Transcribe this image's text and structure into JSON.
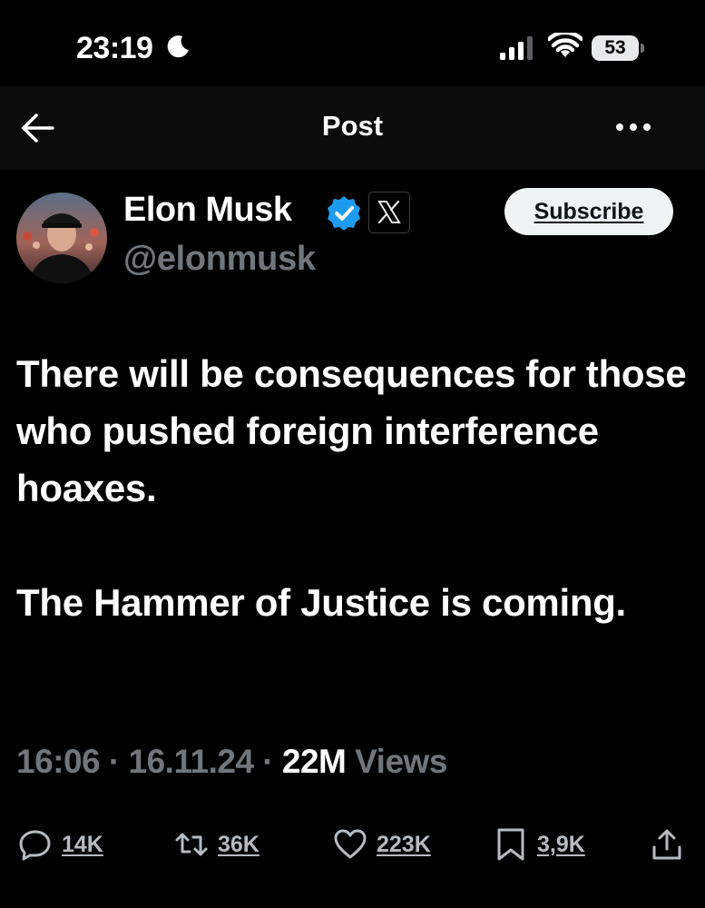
{
  "status_bar": {
    "time": "23:19",
    "battery": "53",
    "icons": [
      "moon-icon",
      "signal-icon",
      "wifi-icon",
      "battery-icon"
    ]
  },
  "nav": {
    "title": "Post",
    "back_icon": "arrow-left-icon",
    "more_icon": "more-horizontal-icon"
  },
  "author": {
    "name": "Elon Musk",
    "handle": "@elonmusk",
    "verified_color": "#1d9bf0",
    "affiliation_icon": "x-logo-icon",
    "subscribe_label": "Subscribe"
  },
  "post": {
    "paragraphs": [
      "There will be consequences for those who pushed foreign interference hoaxes.",
      "The Hammer of Justice is coming."
    ],
    "time": "16:06",
    "date": "16.11.24",
    "views_count": "22M",
    "views_label": "Views"
  },
  "actions": {
    "replies": "14K",
    "reposts": "36K",
    "likes": "223K",
    "bookmarks": "3,9K"
  },
  "colors": {
    "background": "#000000",
    "text": "#ffffff",
    "secondary": "#71767b",
    "accent": "#1d9bf0"
  }
}
